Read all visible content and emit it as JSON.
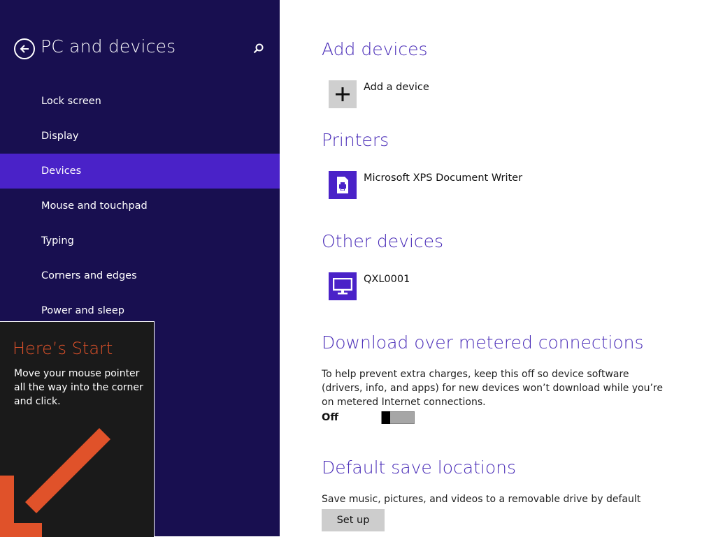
{
  "sidebar": {
    "title": "PC and devices",
    "back_icon": "back-arrow-circle-icon",
    "search_icon": "search-icon",
    "items": [
      {
        "label": "Lock screen"
      },
      {
        "label": "Display"
      },
      {
        "label": "Devices",
        "selected": true
      },
      {
        "label": "Mouse and touchpad"
      },
      {
        "label": "Typing"
      },
      {
        "label": "Corners and edges"
      },
      {
        "label": "Power and sleep"
      }
    ]
  },
  "tip": {
    "title": "Here’s Start",
    "body": "Move your mouse pointer all the way into the corner and click.",
    "arrow_icon": "arrow-down-left-icon"
  },
  "main": {
    "add_devices": {
      "title": "Add devices",
      "add_label": "Add a device",
      "icon": "plus-icon"
    },
    "printers": {
      "title": "Printers",
      "items": [
        {
          "label": "Microsoft XPS Document Writer",
          "icon": "printer-icon"
        }
      ]
    },
    "other_devices": {
      "title": "Other devices",
      "items": [
        {
          "label": "QXL0001",
          "icon": "monitor-icon"
        }
      ]
    },
    "metered": {
      "title": "Download over metered connections",
      "description": "To help prevent extra charges, keep this off so device software (drivers, info, and apps) for new devices won’t download while you’re on metered Internet connections.",
      "toggle_state": "Off"
    },
    "save_locations": {
      "title": "Default save locations",
      "description": "Save music, pictures, and videos to a removable drive by default",
      "button_label": "Set up"
    }
  },
  "colors": {
    "sidebar_bg": "#180f50",
    "selected_bg": "#4a22c8",
    "heading": "#4a2db8",
    "tip_accent": "#e0522a"
  }
}
